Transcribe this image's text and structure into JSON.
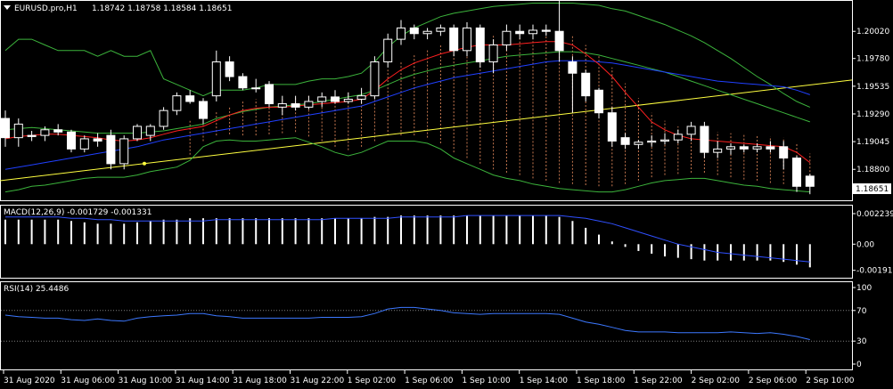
{
  "header": {
    "symbol": "EURUSD.pro,H1",
    "ohlc": "1.18742 1.18758 1.18584 1.18651"
  },
  "price_panel": {
    "axis_ticks": [
      "1.20020",
      "1.19780",
      "1.19535",
      "1.19290",
      "1.19045",
      "1.18800"
    ],
    "current_price": "1.18651"
  },
  "macd_panel": {
    "label": "MACD(12,26,9) -0.001729 -0.001331",
    "axis_ticks": [
      "0.002239",
      "0.00",
      "-0.001918"
    ]
  },
  "rsi_panel": {
    "label": "RSI(14) 25.4486",
    "axis_ticks": [
      "100",
      "70",
      "30",
      "0"
    ]
  },
  "time_axis": [
    "31 Aug 2020",
    "31 Aug 06:00",
    "31 Aug 10:00",
    "31 Aug 14:00",
    "31 Aug 18:00",
    "31 Aug 22:00",
    "1 Sep 02:00",
    "1 Sep 06:00",
    "1 Sep 10:00",
    "1 Sep 14:00",
    "1 Sep 18:00",
    "1 Sep 22:00",
    "2 Sep 02:00",
    "2 Sep 06:00",
    "2 Sep 10:00"
  ],
  "colors": {
    "background": "#000000",
    "bull_candle": "#000000",
    "bear_candle": "#ffffff",
    "candle_outline": "#ffffff",
    "bollinger": "#3cb43c",
    "ma_red": "#ff2020",
    "ma_blue": "#2040ff",
    "trendline": "#ffff40",
    "ichimoku_cloud": "#c87850",
    "macd_signal": "#3050ff",
    "rsi_line": "#3c78ff",
    "grid_level": "#808080"
  },
  "chart_data": {
    "type": "candlestick",
    "symbol": "EURUSD.pro",
    "timeframe": "H1",
    "ylim": [
      1.1855,
      1.2025
    ],
    "candles": [
      {
        "o": 1.1925,
        "h": 1.1932,
        "l": 1.19,
        "c": 1.1908
      },
      {
        "o": 1.1908,
        "h": 1.1925,
        "l": 1.19,
        "c": 1.192
      },
      {
        "o": 1.191,
        "h": 1.1914,
        "l": 1.1905,
        "c": 1.1909
      },
      {
        "o": 1.191,
        "h": 1.1918,
        "l": 1.1905,
        "c": 1.1915
      },
      {
        "o": 1.1915,
        "h": 1.192,
        "l": 1.191,
        "c": 1.1913
      },
      {
        "o": 1.1913,
        "h": 1.1915,
        "l": 1.1895,
        "c": 1.1898
      },
      {
        "o": 1.1898,
        "h": 1.191,
        "l": 1.1895,
        "c": 1.1907
      },
      {
        "o": 1.1907,
        "h": 1.1912,
        "l": 1.19,
        "c": 1.1905
      },
      {
        "o": 1.191,
        "h": 1.1915,
        "l": 1.188,
        "c": 1.1885
      },
      {
        "o": 1.1885,
        "h": 1.191,
        "l": 1.188,
        "c": 1.1907
      },
      {
        "o": 1.1907,
        "h": 1.192,
        "l": 1.1905,
        "c": 1.1918
      },
      {
        "o": 1.191,
        "h": 1.192,
        "l": 1.1905,
        "c": 1.1918
      },
      {
        "o": 1.1918,
        "h": 1.1935,
        "l": 1.1915,
        "c": 1.1932
      },
      {
        "o": 1.1932,
        "h": 1.1948,
        "l": 1.1928,
        "c": 1.1945
      },
      {
        "o": 1.1945,
        "h": 1.195,
        "l": 1.1938,
        "c": 1.194
      },
      {
        "o": 1.194,
        "h": 1.1943,
        "l": 1.192,
        "c": 1.1925
      },
      {
        "o": 1.1945,
        "h": 1.1985,
        "l": 1.194,
        "c": 1.1975
      },
      {
        "o": 1.1975,
        "h": 1.198,
        "l": 1.1958,
        "c": 1.1962
      },
      {
        "o": 1.1962,
        "h": 1.1965,
        "l": 1.195,
        "c": 1.1952
      },
      {
        "o": 1.1952,
        "h": 1.196,
        "l": 1.1948,
        "c": 1.1952
      },
      {
        "o": 1.1955,
        "h": 1.1958,
        "l": 1.1935,
        "c": 1.1938
      },
      {
        "o": 1.1935,
        "h": 1.1945,
        "l": 1.1928,
        "c": 1.1938
      },
      {
        "o": 1.1938,
        "h": 1.1945,
        "l": 1.1932,
        "c": 1.1935
      },
      {
        "o": 1.1935,
        "h": 1.1945,
        "l": 1.1933,
        "c": 1.194
      },
      {
        "o": 1.194,
        "h": 1.1948,
        "l": 1.1935,
        "c": 1.1944
      },
      {
        "o": 1.1944,
        "h": 1.195,
        "l": 1.1938,
        "c": 1.194
      },
      {
        "o": 1.194,
        "h": 1.1948,
        "l": 1.1938,
        "c": 1.1942
      },
      {
        "o": 1.1942,
        "h": 1.1952,
        "l": 1.1938,
        "c": 1.1945
      },
      {
        "o": 1.1945,
        "h": 1.198,
        "l": 1.1942,
        "c": 1.1975
      },
      {
        "o": 1.1975,
        "h": 1.2,
        "l": 1.197,
        "c": 1.1995
      },
      {
        "o": 1.1995,
        "h": 1.2012,
        "l": 1.199,
        "c": 1.2005
      },
      {
        "o": 1.2005,
        "h": 1.2008,
        "l": 1.1995,
        "c": 1.2
      },
      {
        "o": 1.2,
        "h": 1.2005,
        "l": 1.1995,
        "c": 1.2002
      },
      {
        "o": 1.2002,
        "h": 1.2008,
        "l": 1.1998,
        "c": 1.2005
      },
      {
        "o": 1.2005,
        "h": 1.2008,
        "l": 1.198,
        "c": 1.1985
      },
      {
        "o": 1.1985,
        "h": 1.201,
        "l": 1.198,
        "c": 1.2005
      },
      {
        "o": 1.2005,
        "h": 1.2008,
        "l": 1.197,
        "c": 1.1975
      },
      {
        "o": 1.1975,
        "h": 1.1995,
        "l": 1.1965,
        "c": 1.199
      },
      {
        "o": 1.199,
        "h": 1.2008,
        "l": 1.1985,
        "c": 1.2002
      },
      {
        "o": 1.2002,
        "h": 1.2008,
        "l": 1.1995,
        "c": 1.2
      },
      {
        "o": 1.2,
        "h": 1.2008,
        "l": 1.1995,
        "c": 1.2003
      },
      {
        "o": 1.2003,
        "h": 1.2008,
        "l": 1.1998,
        "c": 1.2002
      },
      {
        "o": 1.2002,
        "h": 1.203,
        "l": 1.1975,
        "c": 1.1985
      },
      {
        "o": 1.1975,
        "h": 1.198,
        "l": 1.193,
        "c": 1.1965
      },
      {
        "o": 1.1965,
        "h": 1.1968,
        "l": 1.194,
        "c": 1.1945
      },
      {
        "o": 1.195,
        "h": 1.1952,
        "l": 1.1925,
        "c": 1.193
      },
      {
        "o": 1.193,
        "h": 1.1935,
        "l": 1.19,
        "c": 1.1905
      },
      {
        "o": 1.1908,
        "h": 1.1912,
        "l": 1.1898,
        "c": 1.1902
      },
      {
        "o": 1.1902,
        "h": 1.1906,
        "l": 1.1898,
        "c": 1.1904
      },
      {
        "o": 1.1904,
        "h": 1.191,
        "l": 1.19,
        "c": 1.1905
      },
      {
        "o": 1.1905,
        "h": 1.1912,
        "l": 1.1902,
        "c": 1.1906
      },
      {
        "o": 1.1906,
        "h": 1.1915,
        "l": 1.1903,
        "c": 1.1911
      },
      {
        "o": 1.1911,
        "h": 1.1922,
        "l": 1.1905,
        "c": 1.1918
      },
      {
        "o": 1.1918,
        "h": 1.1922,
        "l": 1.189,
        "c": 1.1895
      },
      {
        "o": 1.1895,
        "h": 1.1905,
        "l": 1.189,
        "c": 1.1898
      },
      {
        "o": 1.1898,
        "h": 1.1903,
        "l": 1.1893,
        "c": 1.19
      },
      {
        "o": 1.19,
        "h": 1.1902,
        "l": 1.1895,
        "c": 1.1898
      },
      {
        "o": 1.1898,
        "h": 1.1903,
        "l": 1.1895,
        "c": 1.19
      },
      {
        "o": 1.19,
        "h": 1.1905,
        "l": 1.1895,
        "c": 1.1898
      },
      {
        "o": 1.19,
        "h": 1.1905,
        "l": 1.188,
        "c": 1.189
      },
      {
        "o": 1.189,
        "h": 1.1892,
        "l": 1.186,
        "c": 1.1865
      },
      {
        "o": 1.1874,
        "h": 1.1876,
        "l": 1.1858,
        "c": 1.1865
      }
    ],
    "bb_upper": [
      1.1985,
      1.1995,
      1.1995,
      1.199,
      1.1985,
      1.1985,
      1.1985,
      1.198,
      1.1985,
      1.198,
      1.198,
      1.1985,
      1.196,
      1.1955,
      1.195,
      1.1945,
      1.195,
      1.195,
      1.195,
      1.1952,
      1.1955,
      1.1955,
      1.1955,
      1.1958,
      1.196,
      1.196,
      1.1962,
      1.1965,
      1.1975,
      1.1988,
      1.1998,
      1.2005,
      1.201,
      1.2015,
      1.2018,
      1.202,
      1.2022,
      1.2024,
      1.2025,
      1.2026,
      1.2027,
      1.2027,
      1.2027,
      1.2027,
      1.2026,
      1.2025,
      1.2022,
      1.202,
      1.2016,
      1.2012,
      1.2008,
      1.2003,
      1.1998,
      1.1992,
      1.1985,
      1.1978,
      1.197,
      1.1962,
      1.1955,
      1.1947,
      1.194,
      1.1935
    ],
    "bb_middle": [
      1.1915,
      1.1916,
      1.1917,
      1.1916,
      1.1915,
      1.1914,
      1.1913,
      1.1912,
      1.1912,
      1.1912,
      1.1912,
      1.1913,
      1.1914,
      1.1916,
      1.1918,
      1.192,
      1.1925,
      1.1928,
      1.1931,
      1.1933,
      1.1935,
      1.1936,
      1.1937,
      1.1938,
      1.194,
      1.1942,
      1.1944,
      1.1946,
      1.195,
      1.1955,
      1.196,
      1.1964,
      1.1967,
      1.197,
      1.1972,
      1.1974,
      1.1976,
      1.1978,
      1.198,
      1.1981,
      1.1982,
      1.1983,
      1.1984,
      1.1984,
      1.1983,
      1.1981,
      1.1978,
      1.1975,
      1.1972,
      1.1969,
      1.1966,
      1.1962,
      1.1958,
      1.1954,
      1.195,
      1.1946,
      1.1942,
      1.1938,
      1.1934,
      1.193,
      1.1926,
      1.1922
    ],
    "bb_lower": [
      1.186,
      1.1862,
      1.1865,
      1.1866,
      1.1868,
      1.187,
      1.1872,
      1.1873,
      1.1873,
      1.1873,
      1.1875,
      1.1878,
      1.188,
      1.1882,
      1.1888,
      1.19,
      1.1905,
      1.1906,
      1.1905,
      1.1905,
      1.1906,
      1.1907,
      1.1908,
      1.1904,
      1.19,
      1.1895,
      1.1892,
      1.1895,
      1.19,
      1.1905,
      1.1905,
      1.1905,
      1.1903,
      1.1898,
      1.189,
      1.1885,
      1.188,
      1.1875,
      1.1872,
      1.187,
      1.1867,
      1.1865,
      1.1863,
      1.1862,
      1.1861,
      1.186,
      1.186,
      1.1862,
      1.1865,
      1.1868,
      1.187,
      1.1871,
      1.1872,
      1.1872,
      1.187,
      1.1868,
      1.1866,
      1.1865,
      1.1863,
      1.1862,
      1.1861,
      1.186
    ],
    "ma_red": [
      1.1907,
      1.1909,
      1.191,
      1.1911,
      1.1911,
      1.191,
      1.1909,
      1.1908,
      1.1906,
      1.1905,
      1.1906,
      1.1908,
      1.1911,
      1.1914,
      1.1916,
      1.1918,
      1.1923,
      1.1928,
      1.1932,
      1.1934,
      1.1935,
      1.1935,
      1.1936,
      1.1937,
      1.1938,
      1.1939,
      1.194,
      1.1942,
      1.195,
      1.196,
      1.1968,
      1.1974,
      1.1978,
      1.1982,
      1.1985,
      1.1988,
      1.199,
      1.199,
      1.199,
      1.1991,
      1.1992,
      1.1993,
      1.1993,
      1.199,
      1.1982,
      1.1973,
      1.1962,
      1.1948,
      1.1935,
      1.1922,
      1.1915,
      1.191,
      1.1907,
      1.1906,
      1.1905,
      1.1904,
      1.1903,
      1.1902,
      1.1901,
      1.19,
      1.1895,
      1.1886
    ],
    "ma_blue": [
      1.188,
      1.1882,
      1.1884,
      1.1886,
      1.1888,
      1.189,
      1.1892,
      1.1894,
      1.1896,
      1.1898,
      1.19,
      1.1903,
      1.1906,
      1.1908,
      1.191,
      1.1912,
      1.1914,
      1.1916,
      1.1918,
      1.192,
      1.1922,
      1.1924,
      1.1926,
      1.1928,
      1.193,
      1.1932,
      1.1934,
      1.1936,
      1.194,
      1.1944,
      1.1948,
      1.1952,
      1.1955,
      1.1958,
      1.1961,
      1.1963,
      1.1965,
      1.1967,
      1.1969,
      1.1971,
      1.1973,
      1.1975,
      1.1976,
      1.1976,
      1.1976,
      1.1975,
      1.1974,
      1.1972,
      1.197,
      1.1968,
      1.1966,
      1.1964,
      1.1962,
      1.196,
      1.1958,
      1.1957,
      1.1956,
      1.1955,
      1.1954,
      1.1953,
      1.195,
      1.1946
    ],
    "trendline": {
      "from": 1.187,
      "to": 1.1959
    },
    "macd_ylim": [
      -0.0022,
      0.0025
    ],
    "macd_hist": [
      0.0018,
      0.0018,
      0.0018,
      0.0018,
      0.0018,
      0.0017,
      0.0016,
      0.0015,
      0.0015,
      0.0015,
      0.0016,
      0.0017,
      0.0018,
      0.0018,
      0.0019,
      0.0019,
      0.0019,
      0.0019,
      0.0019,
      0.0019,
      0.0019,
      0.0019,
      0.0019,
      0.0019,
      0.0019,
      0.0019,
      0.0019,
      0.0019,
      0.002,
      0.002,
      0.0021,
      0.0021,
      0.0021,
      0.0021,
      0.0021,
      0.0021,
      0.0021,
      0.0021,
      0.0021,
      0.0021,
      0.0021,
      0.0021,
      0.002,
      0.0017,
      0.0012,
      0.0007,
      0.0002,
      -0.0002,
      -0.0005,
      -0.0007,
      -0.0009,
      -0.001,
      -0.0011,
      -0.0012,
      -0.0012,
      -0.0012,
      -0.0012,
      -0.0012,
      -0.0012,
      -0.0013,
      -0.0015,
      -0.0017
    ],
    "macd_signal": [
      0.002,
      0.002,
      0.002,
      0.002,
      0.002,
      0.0019,
      0.0019,
      0.0018,
      0.0018,
      0.0017,
      0.0017,
      0.0017,
      0.0017,
      0.0017,
      0.0017,
      0.0017,
      0.0018,
      0.0018,
      0.0018,
      0.0018,
      0.0018,
      0.0018,
      0.0018,
      0.0018,
      0.0018,
      0.0019,
      0.0019,
      0.0019,
      0.0019,
      0.0019,
      0.002,
      0.002,
      0.002,
      0.002,
      0.002,
      0.0021,
      0.0021,
      0.0021,
      0.0021,
      0.0021,
      0.0021,
      0.0021,
      0.0021,
      0.002,
      0.0019,
      0.0017,
      0.0015,
      0.0012,
      0.0009,
      0.0006,
      0.0003,
      0.0,
      -0.0002,
      -0.0004,
      -0.0006,
      -0.0007,
      -0.0008,
      -0.0009,
      -0.001,
      -0.0011,
      -0.0012,
      -0.0013
    ],
    "rsi": [
      64,
      62,
      61,
      60,
      60,
      58,
      57,
      59,
      57,
      56,
      60,
      62,
      63,
      64,
      66,
      66,
      63,
      62,
      60,
      60,
      60,
      60,
      60,
      60,
      61,
      61,
      61,
      62,
      66,
      72,
      74,
      74,
      72,
      70,
      67,
      66,
      65,
      66,
      66,
      66,
      66,
      66,
      65,
      60,
      55,
      52,
      48,
      44,
      42,
      42,
      42,
      41,
      41,
      41,
      41,
      42,
      41,
      40,
      41,
      39,
      36,
      32
    ]
  }
}
